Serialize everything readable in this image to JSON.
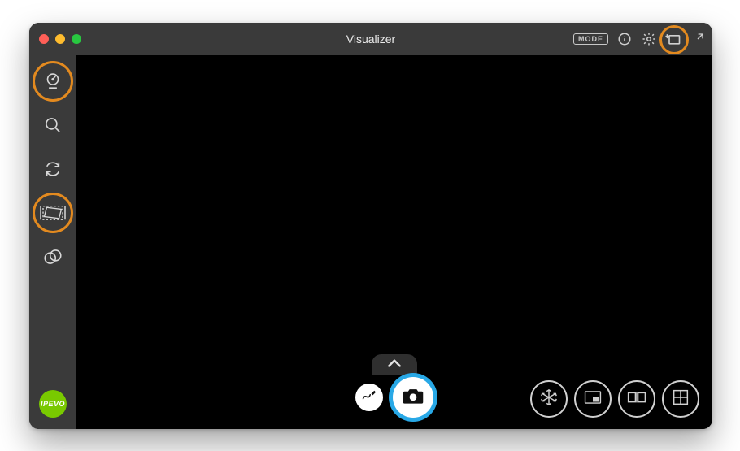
{
  "window": {
    "title": "Visualizer"
  },
  "titlebar_right": {
    "mode_label": "MODE",
    "info_icon": "info-icon",
    "settings_icon": "gear-icon",
    "add_window_icon": "add-window-icon",
    "fullscreen_icon": "expand-icon"
  },
  "sidebar": {
    "items": [
      {
        "name": "camera-select-icon",
        "highlighted": true
      },
      {
        "name": "magnifier-icon",
        "highlighted": false
      },
      {
        "name": "rotate-icon",
        "highlighted": false
      },
      {
        "name": "keystone-icon",
        "highlighted": true
      },
      {
        "name": "filters-icon",
        "highlighted": false
      }
    ]
  },
  "brand": {
    "label": "IPEVO",
    "color": "#79c900"
  },
  "bottom": {
    "expand_icon": "chevron-up-icon",
    "annotate_icon": "scribble-icon",
    "capture_icon": "camera-icon"
  },
  "bottom_right": {
    "items": [
      {
        "name": "freeze-icon"
      },
      {
        "name": "pip-icon"
      },
      {
        "name": "book-split-icon"
      },
      {
        "name": "grid-split-icon"
      }
    ]
  },
  "highlights": {
    "titlebar_add_window": true
  }
}
